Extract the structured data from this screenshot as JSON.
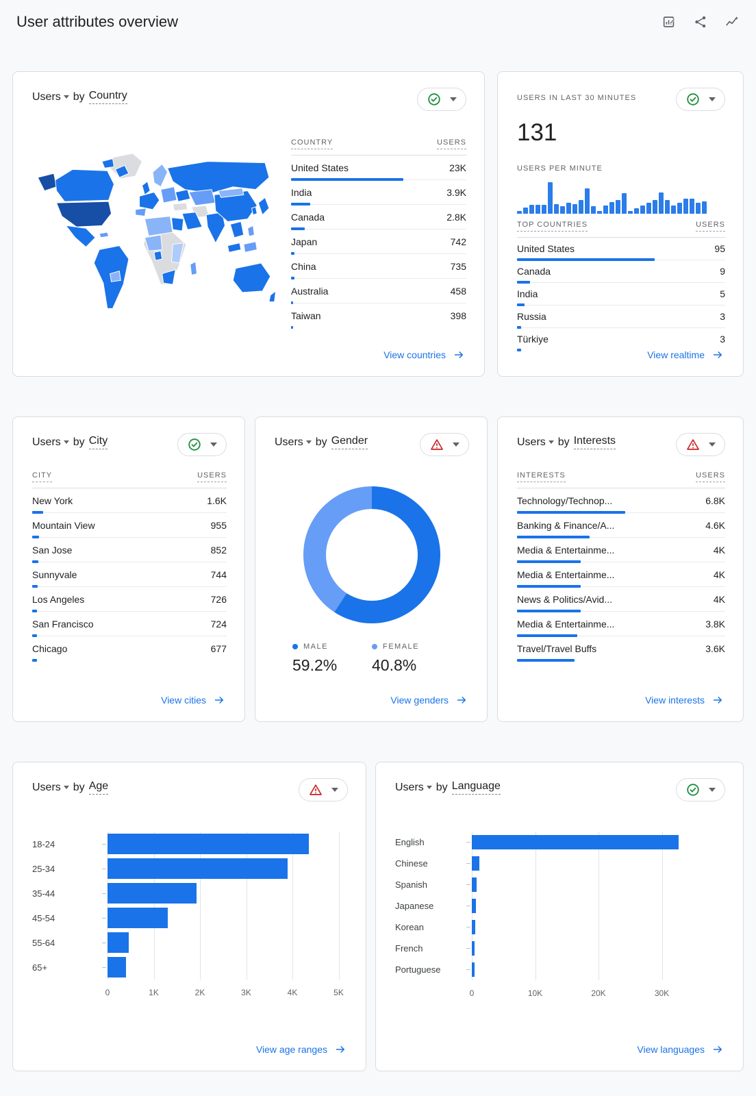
{
  "header": {
    "title": "User attributes overview",
    "icons": [
      "edit-report-icon",
      "share-icon",
      "insights-icon"
    ]
  },
  "colors": {
    "blue": "#1a73e8",
    "blue_dark": "#174ea6",
    "male": "#1a73e8",
    "female": "#669df6",
    "green": "#1e8e3e",
    "red": "#c5221f",
    "link": "#1a73e8"
  },
  "cards": {
    "country": {
      "title": {
        "users": "Users",
        "by": "by",
        "dim": "Country"
      },
      "status": "ok",
      "table": {
        "col1": "COUNTRY",
        "col2": "USERS",
        "rows": [
          [
            "United States",
            "23K",
            64
          ],
          [
            "India",
            "3.9K",
            10.9
          ],
          [
            "Canada",
            "2.8K",
            7.8
          ],
          [
            "Japan",
            "742",
            2.1
          ],
          [
            "China",
            "735",
            2.0
          ],
          [
            "Australia",
            "458",
            1.3
          ],
          [
            "Taiwan",
            "398",
            1.1
          ]
        ]
      },
      "footer": "View countries"
    },
    "realtime": {
      "label": "USERS IN LAST 30 MINUTES",
      "value": "131",
      "spark_label": "USERS PER MINUTE",
      "status": "ok",
      "table": {
        "col1": "TOP COUNTRIES",
        "col2": "USERS",
        "rows": [
          [
            "United States",
            "95",
            66
          ],
          [
            "Canada",
            "9",
            6.3
          ],
          [
            "India",
            "5",
            3.5
          ],
          [
            "Russia",
            "3",
            2.1
          ],
          [
            "Türkiye",
            "3",
            2.1
          ]
        ]
      },
      "footer": "View realtime"
    },
    "city": {
      "title": {
        "users": "Users",
        "by": "by",
        "dim": "City"
      },
      "status": "ok",
      "table": {
        "col1": "CITY",
        "col2": "USERS",
        "rows": [
          [
            "New York",
            "1.6K",
            5.5
          ],
          [
            "Mountain View",
            "955",
            3.4
          ],
          [
            "San Jose",
            "852",
            3.0
          ],
          [
            "Sunnyvale",
            "744",
            2.7
          ],
          [
            "Los Angeles",
            "726",
            2.6
          ],
          [
            "San Francisco",
            "724",
            2.6
          ],
          [
            "Chicago",
            "677",
            2.4
          ]
        ]
      },
      "footer": "View cities"
    },
    "gender": {
      "title": {
        "users": "Users",
        "by": "by",
        "dim": "Gender"
      },
      "status": "warn",
      "legend": [
        {
          "label": "MALE",
          "pct": "59.2%"
        },
        {
          "label": "FEMALE",
          "pct": "40.8%"
        }
      ],
      "footer": "View genders"
    },
    "interests": {
      "title": {
        "users": "Users",
        "by": "by",
        "dim": "Interests"
      },
      "status": "warn",
      "table": {
        "col1": "INTERESTS",
        "col2": "USERS",
        "rows": [
          [
            "Technology/Technop...",
            "6.8K",
            52
          ],
          [
            "Banking & Finance/A...",
            "4.6K",
            35
          ],
          [
            "Media & Entertainme...",
            "4K",
            30.6
          ],
          [
            "Media & Entertainme...",
            "4K",
            30.6
          ],
          [
            "News & Politics/Avid...",
            "4K",
            30.6
          ],
          [
            "Media & Entertainme...",
            "3.8K",
            29
          ],
          [
            "Travel/Travel Buffs",
            "3.6K",
            27.5
          ]
        ]
      },
      "footer": "View interests"
    },
    "age": {
      "title": {
        "users": "Users",
        "by": "by",
        "dim": "Age"
      },
      "status": "warn",
      "footer": "View age ranges"
    },
    "language": {
      "title": {
        "users": "Users",
        "by": "by",
        "dim": "Language"
      },
      "status": "ok",
      "footer": "View languages"
    }
  },
  "chart_data": [
    {
      "id": "users_per_minute",
      "type": "bar",
      "title": "Users per minute",
      "note": "30-minute realtime sparkline, unlabeled axis, heights relative 0-100",
      "values": [
        8,
        18,
        28,
        28,
        28,
        95,
        30,
        22,
        33,
        30,
        42,
        78,
        22,
        9,
        26,
        36,
        42,
        62,
        9,
        16,
        26,
        34,
        42,
        64,
        42,
        26,
        34,
        46,
        46,
        34,
        38
      ]
    },
    {
      "id": "gender_donut",
      "type": "pie",
      "title": "Users by Gender",
      "labels": [
        "Male",
        "Female"
      ],
      "values": [
        59.2,
        40.8
      ]
    },
    {
      "id": "age",
      "type": "bar",
      "orientation": "horizontal",
      "title": "Users by Age",
      "categories": [
        "18-24",
        "25-34",
        "35-44",
        "45-54",
        "55-64",
        "65+"
      ],
      "values": [
        4350,
        3900,
        1920,
        1300,
        460,
        400
      ],
      "xmax": 5200,
      "ticks": [
        0,
        1000,
        2000,
        3000,
        4000,
        5000
      ],
      "tick_labels": [
        "0",
        "1K",
        "2K",
        "3K",
        "4K",
        "5K"
      ]
    },
    {
      "id": "language",
      "type": "bar",
      "orientation": "horizontal",
      "title": "Users by Language",
      "categories": [
        "English",
        "Chinese",
        "Spanish",
        "Japanese",
        "Korean",
        "French",
        "Portuguese"
      ],
      "values": [
        32700,
        1200,
        800,
        700,
        500,
        480,
        380
      ],
      "xmax": 40000,
      "ticks": [
        0,
        10000,
        20000,
        30000
      ],
      "tick_labels": [
        "0",
        "10K",
        "20K",
        "30K"
      ]
    }
  ]
}
